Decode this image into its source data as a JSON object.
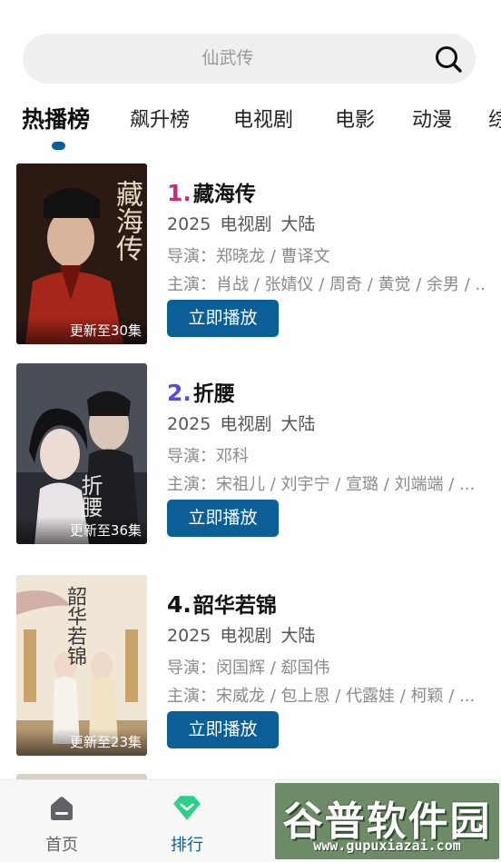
{
  "search": {
    "placeholder": "仙武传"
  },
  "tabs": [
    {
      "label": "热播榜",
      "active": true
    },
    {
      "label": "飙升榜"
    },
    {
      "label": "电视剧"
    },
    {
      "label": "电影"
    },
    {
      "label": "动漫"
    },
    {
      "label": "综"
    }
  ],
  "items": [
    {
      "rank": "1.",
      "rank_color": "#cc2b7a",
      "title": "藏海传",
      "meta": "2025 电视剧 大陆",
      "director": "导演：郑晓龙 / 曹译文",
      "cast": "主演：肖战 / 张婧仪 / 周奇 / 黄觉 / 余男 / ...",
      "badge": "更新至30集",
      "poster_text": "藏海传",
      "play_label": "立即播放"
    },
    {
      "rank": "2.",
      "rank_color": "#5a49d6",
      "title": "折腰",
      "meta": "2025 电视剧 大陆",
      "director": "导演：邓科",
      "cast": "主演：宋祖儿 / 刘宇宁 / 宣璐 / 刘端端 / ...",
      "badge": "更新至36集",
      "poster_text": "折腰",
      "play_label": "立即播放"
    },
    {
      "rank": "4.",
      "rank_color": "#111111",
      "title": "韶华若锦",
      "meta": "2025 电视剧 大陆",
      "director": "导演：闵国辉 / 郄国伟",
      "cast": "主演：宋威龙 / 包上恩 / 代露娃 / 柯颖 / ...",
      "badge": "更新至23集",
      "poster_text": "韶华若锦",
      "play_label": "立即播放"
    }
  ],
  "bottom_nav": [
    {
      "label": "首页",
      "icon": "home-icon"
    },
    {
      "label": "排行",
      "icon": "ranking-diamond-icon",
      "active": true
    }
  ],
  "watermark": {
    "title": "谷普软件园",
    "url": "www.gupuxiazai.com"
  },
  "colors": {
    "accent": "#0c5e97",
    "ranking_icon": "#2fcf8a"
  }
}
